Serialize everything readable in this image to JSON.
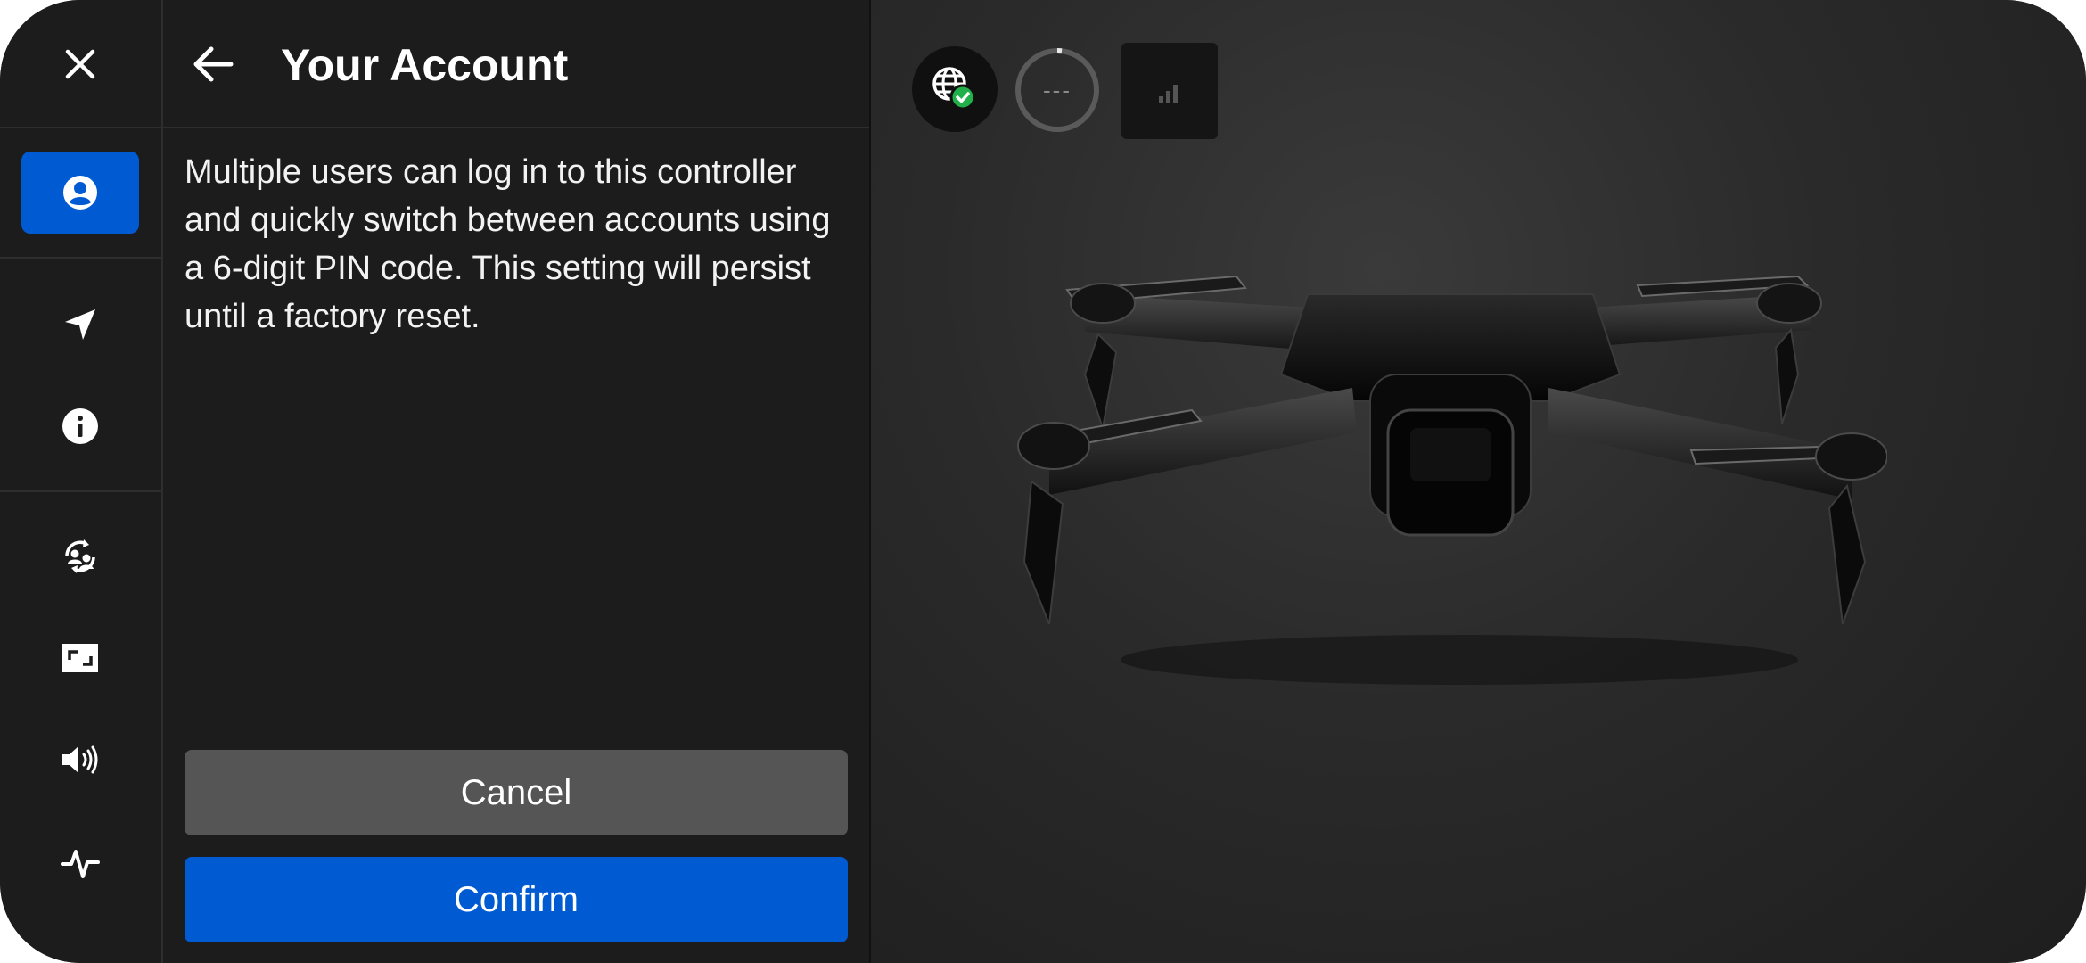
{
  "rail": {
    "items": [
      {
        "icon": "close-icon"
      },
      {
        "icon": "account-icon",
        "active": true
      },
      {
        "icon": "navigation-arrow-icon"
      },
      {
        "icon": "info-icon"
      },
      {
        "icon": "switch-user-icon"
      },
      {
        "icon": "aspect-ratio-icon"
      },
      {
        "icon": "speaker-icon"
      },
      {
        "icon": "activity-pulse-icon"
      }
    ]
  },
  "panel": {
    "title": "Your Account",
    "description": "Multiple users can log in to this controller and quickly switch between accounts using a 6-digit PIN code. This setting will persist until a factory reset.",
    "cancel_label": "Cancel",
    "confirm_label": "Confirm"
  },
  "status": {
    "network_icon": "globe-check-icon",
    "battery_text": "---",
    "signal_icon": "signal-bars-icon"
  },
  "colors": {
    "accent": "#005bd3",
    "cancel": "#555555",
    "panel_bg": "#1c1c1c",
    "check": "#22b04b"
  }
}
